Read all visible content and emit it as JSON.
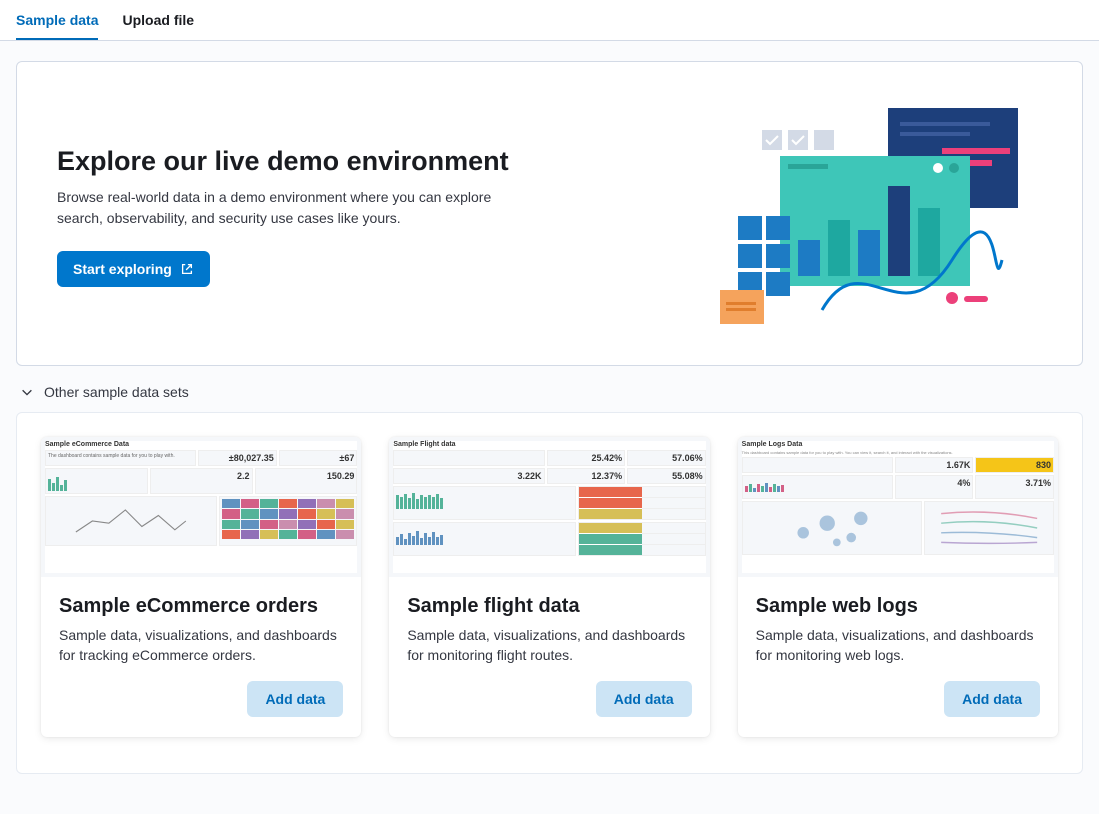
{
  "tabs": {
    "sample_data": "Sample data",
    "upload_file": "Upload file"
  },
  "hero": {
    "title": "Explore our live demo environment",
    "description": "Browse real-world data in a demo environment where you can explore search, observability, and security use cases like yours.",
    "button_label": "Start exploring"
  },
  "collapse": {
    "title": "Other sample data sets"
  },
  "cards": [
    {
      "title": "Sample eCommerce orders",
      "description": "Sample data, visualizations, and dashboards for tracking eCommerce orders.",
      "button_label": "Add data",
      "preview_title": "Sample eCommerce Data",
      "preview_metrics": {
        "a": "±80,027.35",
        "b": "±67",
        "c": "2.2",
        "d": "150.29"
      }
    },
    {
      "title": "Sample flight data",
      "description": "Sample data, visualizations, and dashboards for monitoring flight routes.",
      "button_label": "Add data",
      "preview_title": "Sample Flight data",
      "preview_metrics": {
        "a": "25.42%",
        "b": "57.06%",
        "c": "3.22K",
        "d": "12.37%",
        "e": "55.08%"
      }
    },
    {
      "title": "Sample web logs",
      "description": "Sample data, visualizations, and dashboards for monitoring web logs.",
      "button_label": "Add data",
      "preview_title": "Sample Logs Data",
      "preview_metrics": {
        "a": "1.67K",
        "b": "830",
        "c": "4%",
        "d": "3.71%"
      }
    }
  ]
}
